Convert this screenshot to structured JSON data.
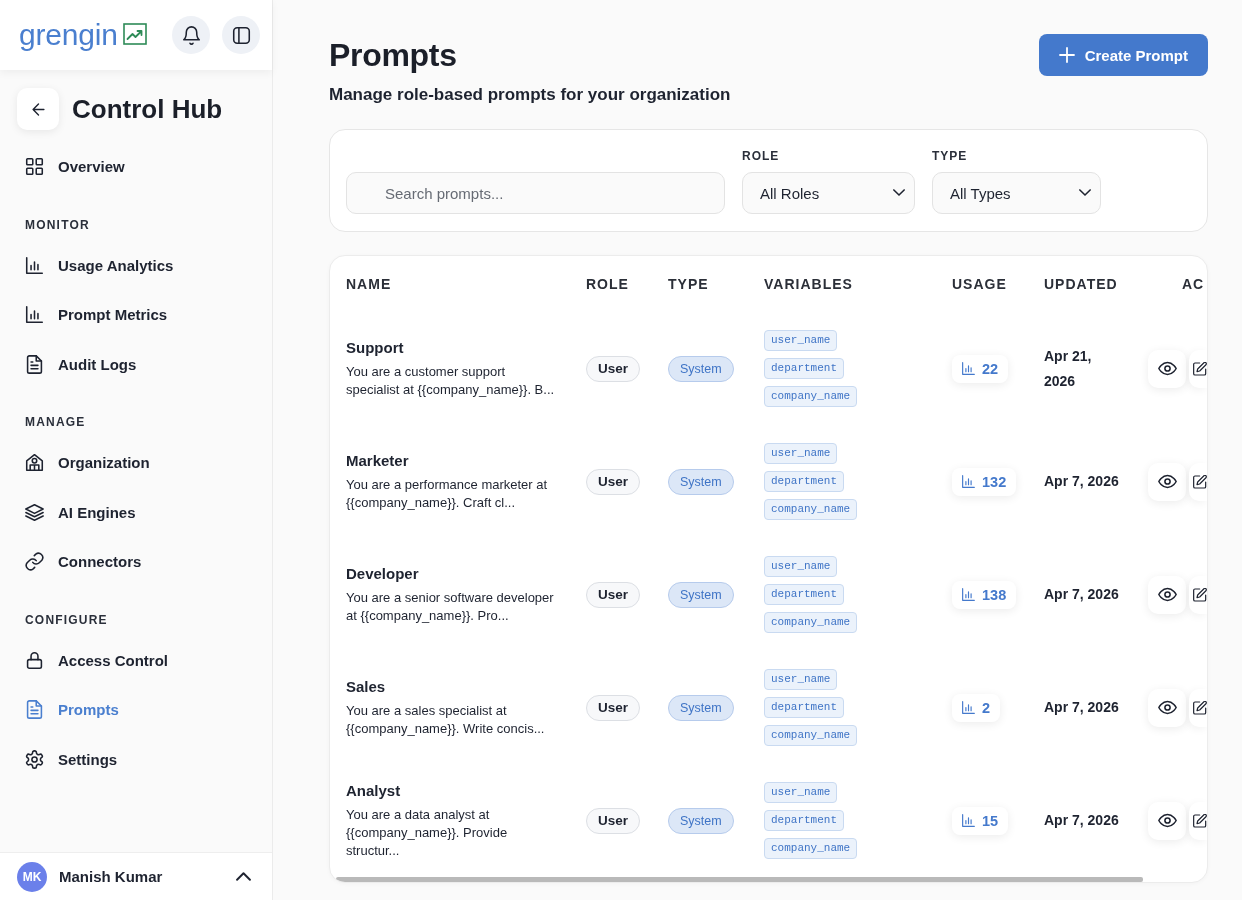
{
  "sidebar": {
    "logo": "grengin",
    "title": "Control Hub",
    "sections": [
      {
        "items": [
          {
            "label": "Overview",
            "selected": false
          }
        ]
      },
      {
        "heading": "MONITOR",
        "items": [
          {
            "label": "Usage Analytics",
            "selected": false
          },
          {
            "label": "Prompt Metrics",
            "selected": false
          },
          {
            "label": "Audit Logs",
            "selected": false
          }
        ]
      },
      {
        "heading": "MANAGE",
        "items": [
          {
            "label": "Organization",
            "selected": false
          },
          {
            "label": "AI Engines",
            "selected": false
          },
          {
            "label": "Connectors",
            "selected": false
          }
        ]
      },
      {
        "heading": "CONFIGURE",
        "items": [
          {
            "label": "Access Control",
            "selected": false
          },
          {
            "label": "Prompts",
            "selected": true
          },
          {
            "label": "Settings",
            "selected": false
          }
        ]
      }
    ],
    "user": {
      "initials": "MK",
      "name": "Manish Kumar"
    }
  },
  "header": {
    "title": "Prompts",
    "subtitle": "Manage role-based prompts for your organization",
    "create_button": "Create Prompt"
  },
  "filters": {
    "search": {
      "placeholder": "Search prompts..."
    },
    "role": {
      "label": "ROLE",
      "value": "All Roles"
    },
    "type": {
      "label": "TYPE",
      "value": "All Types"
    }
  },
  "table": {
    "columns": [
      "NAME",
      "ROLE",
      "TYPE",
      "VARIABLES",
      "USAGE",
      "UPDATED",
      "AC"
    ],
    "rows": [
      {
        "name": "Support",
        "description": "You are a customer support specialist at {{company_name}}. B...",
        "role": "User",
        "type": "System",
        "variables": [
          "user_name",
          "department",
          "company_name"
        ],
        "usage": "22",
        "updated": "Apr 21, 2026"
      },
      {
        "name": "Marketer",
        "description": "You are a performance marketer at {{company_name}}. Craft cl...",
        "role": "User",
        "type": "System",
        "variables": [
          "user_name",
          "department",
          "company_name"
        ],
        "usage": "132",
        "updated": "Apr 7, 2026"
      },
      {
        "name": "Developer",
        "description": "You are a senior software developer at {{company_name}}. Pro...",
        "role": "User",
        "type": "System",
        "variables": [
          "user_name",
          "department",
          "company_name"
        ],
        "usage": "138",
        "updated": "Apr 7, 2026"
      },
      {
        "name": "Sales",
        "description": "You are a sales specialist at {{company_name}}. Write concis...",
        "role": "User",
        "type": "System",
        "variables": [
          "user_name",
          "department",
          "company_name"
        ],
        "usage": "2",
        "updated": "Apr 7, 2026"
      },
      {
        "name": "Analyst",
        "description": "You are a data analyst at {{company_name}}. Provide structur...",
        "role": "User",
        "type": "System",
        "variables": [
          "user_name",
          "department",
          "company_name"
        ],
        "usage": "15",
        "updated": "Apr 7, 2026"
      }
    ]
  }
}
